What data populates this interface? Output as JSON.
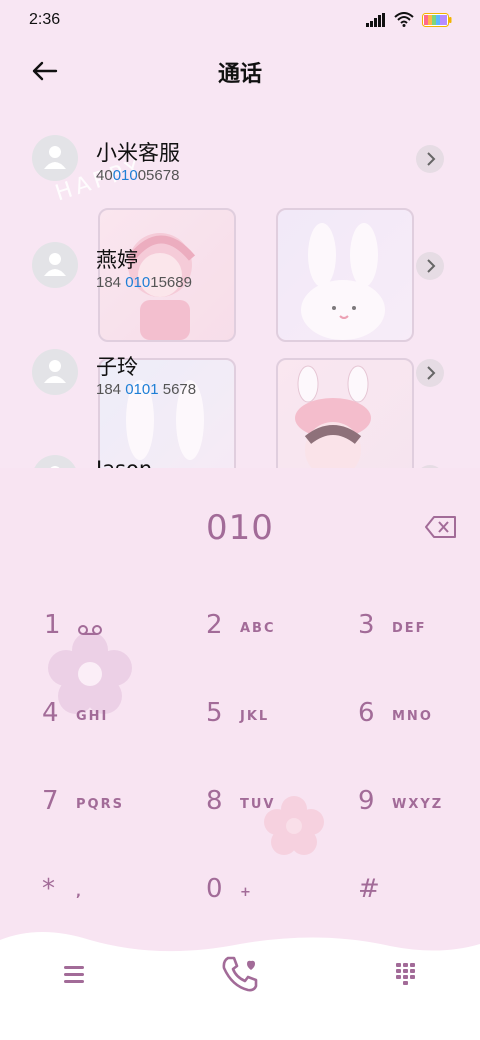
{
  "status": {
    "time": "2:36",
    "icons": [
      "signal-icon",
      "wifi-icon",
      "battery-icon"
    ]
  },
  "header": {
    "title": "通话",
    "back_icon": "arrow-left-icon"
  },
  "contacts": [
    {
      "name": "小米客服",
      "number_pre": "40",
      "number_hl": "010",
      "number_post": "05678"
    },
    {
      "name": "燕婷",
      "number_pre": "184 ",
      "number_hl": "010",
      "number_post": "15689"
    },
    {
      "name": "子玲",
      "number_pre": "184 ",
      "number_hl": "0101",
      "number_post": " 5678"
    },
    {
      "name": "Jason",
      "number_pre": "",
      "number_hl": "",
      "number_post": ""
    }
  ],
  "deco_text": "HAPPY",
  "dialpad": {
    "entered_digits": "010",
    "keys": [
      {
        "num": "1",
        "letters": ""
      },
      {
        "num": "2",
        "letters": "ABC"
      },
      {
        "num": "3",
        "letters": "DEF"
      },
      {
        "num": "4",
        "letters": "GHI"
      },
      {
        "num": "5",
        "letters": "JKL"
      },
      {
        "num": "6",
        "letters": "MNO"
      },
      {
        "num": "7",
        "letters": "PQRS"
      },
      {
        "num": "8",
        "letters": "TUV"
      },
      {
        "num": "9",
        "letters": "WXYZ"
      },
      {
        "num": "*",
        "letters": ","
      },
      {
        "num": "0",
        "letters": "+"
      },
      {
        "num": "#",
        "letters": ""
      }
    ]
  },
  "colors": {
    "background": "#f8e6f3",
    "dial_accent": "#a26b98",
    "highlight": "#1e7fd6"
  }
}
